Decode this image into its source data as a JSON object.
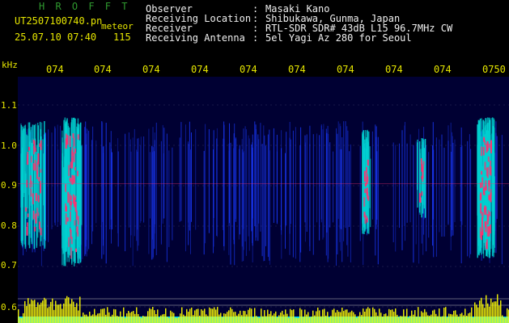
{
  "header": {
    "app_title": "H R O F F T",
    "file_name": "UT2507100740.pn",
    "file_suffix": "meteor",
    "datetime": "25.07.10 07:40",
    "count": "115",
    "meta": [
      {
        "label": "Observer",
        "value": "Masaki Kano"
      },
      {
        "label": "Receiving Location",
        "value": "Shibukawa, Gunma, Japan"
      },
      {
        "label": "Receiver",
        "value": "RTL-SDR SDR# 43dB L15 96.7MHz CW"
      },
      {
        "label": "Receiving Antenna",
        "value": "5el Yagi Az 280 for Seoul"
      }
    ],
    "colon": ":"
  },
  "chart_data": {
    "type": "heatmap",
    "ylabel": "kHz",
    "y_ticks": [
      "1.1",
      "1.0",
      "0.9",
      "0.8",
      "0.7",
      "0.6"
    ],
    "x_ticks": [
      "074",
      "074",
      "074",
      "074",
      "074",
      "074",
      "074",
      "074",
      "074",
      "0750"
    ],
    "ylim": [
      0.6,
      1.1
    ],
    "grid": true,
    "colors": {
      "background": "#000033",
      "noise": "#1a3aff",
      "mid": "#00d0d0",
      "strong": "#ff3070",
      "amplitude": "#ffff00",
      "amplitude_base": "#00d8ff"
    }
  }
}
